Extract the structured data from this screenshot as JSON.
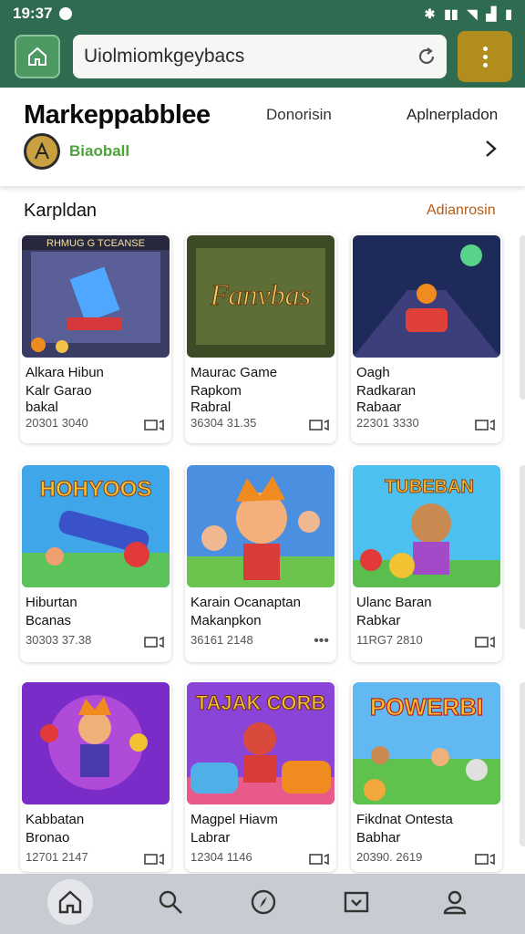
{
  "status": {
    "time": "19:37"
  },
  "url_bar": {
    "text": "Uiolmiomkgeybacs"
  },
  "header": {
    "title": "Markeppabblee",
    "tabs": [
      "Donorisin",
      "Aplnerpladon"
    ],
    "brand": "Biaoball"
  },
  "section": {
    "title": "Karpldan",
    "link": "Adianrosin"
  },
  "cards": [
    {
      "l1": "Alkara Hibun",
      "l2": "Kalr Garao",
      "l3": "bakal",
      "meta": "20301 3040",
      "thumb_text": "RHMUG G TCEANSE"
    },
    {
      "l1": "Maurac Game",
      "l2": "Rapkom",
      "l3": "Rabral",
      "meta": "36304 31.35",
      "thumb_text": "Fanvbas"
    },
    {
      "l1": "Oagh",
      "l2": "Radkaran",
      "l3": "Rabaar",
      "meta": "22301 3330",
      "thumb_text": ""
    },
    {
      "l1": "Hiburtan",
      "l2": "Bcanas",
      "l3": "",
      "meta": "30303 37.38",
      "thumb_text": "HOHYOOS"
    },
    {
      "l1": "Karain Ocanaptan",
      "l2": "Makanpkon",
      "l3": "",
      "meta": "36161 2148",
      "thumb_text": ""
    },
    {
      "l1": "Ulanc Baran",
      "l2": "Rabkar",
      "l3": "",
      "meta": "11RG7 2810",
      "thumb_text": "TUBEBAN"
    },
    {
      "l1": "Kabbatan",
      "l2": "Bronao",
      "l3": "",
      "meta": "12701 2147",
      "thumb_text": ""
    },
    {
      "l1": "Magpel Hiavm",
      "l2": "Labrar",
      "l3": "",
      "meta": "12304 1146",
      "thumb_text": "TAJAK CORB"
    },
    {
      "l1": "Fikdnat Ontesta",
      "l2": "Babhar",
      "l3": "",
      "meta": "20390. 2619",
      "thumb_text": "POWERBI"
    }
  ],
  "colors": {
    "bar": "#2f6b50",
    "accent": "#b08d1c",
    "brand": "#4ea33a",
    "link": "#b85a10"
  },
  "nav": [
    "home-icon",
    "search-icon",
    "compass-icon",
    "download-icon",
    "profile-icon"
  ]
}
